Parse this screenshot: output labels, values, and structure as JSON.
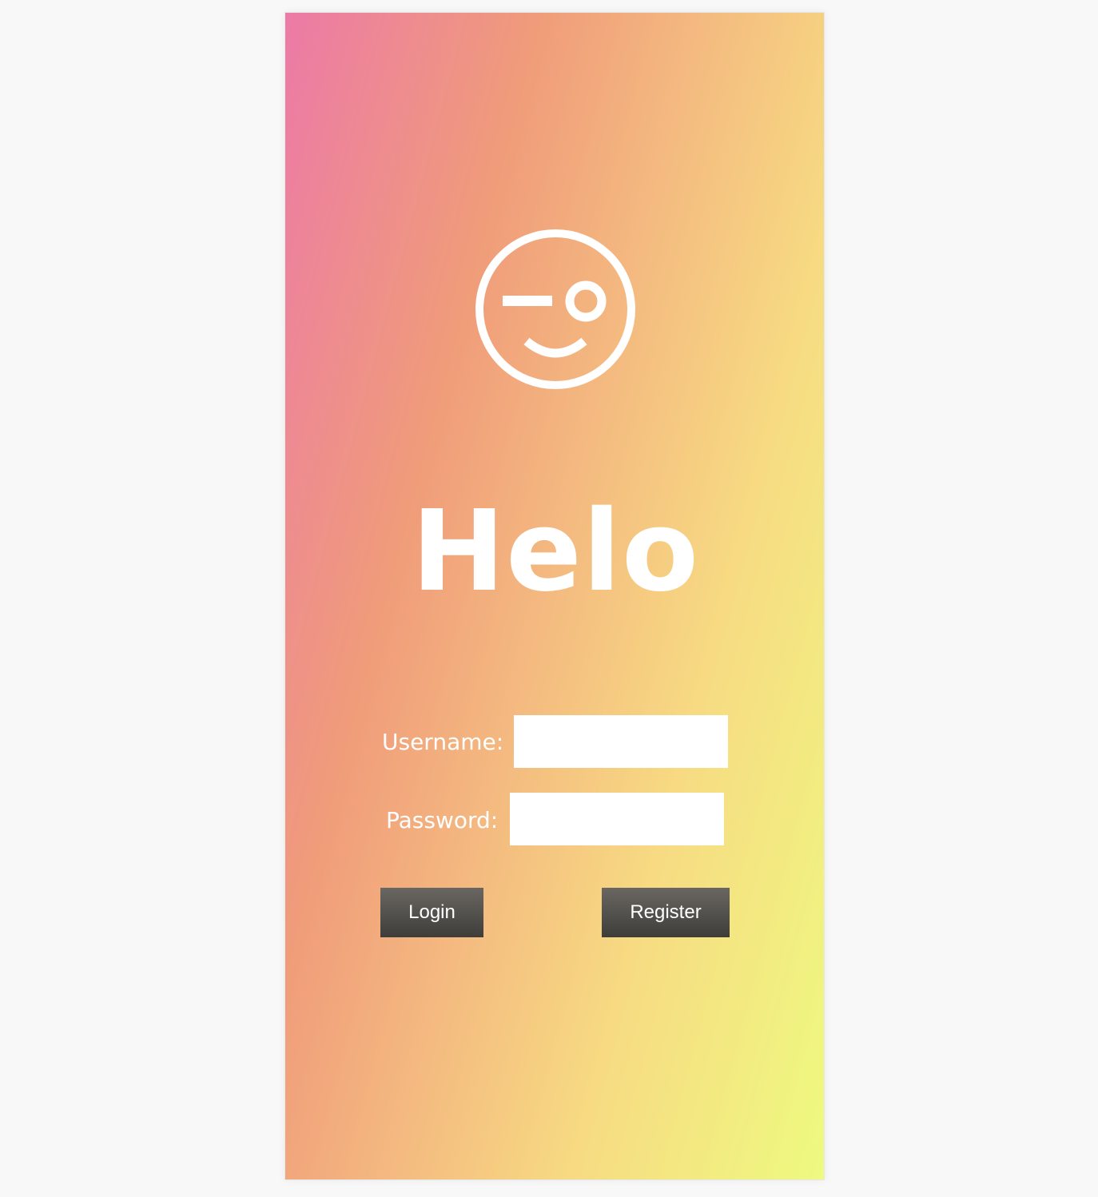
{
  "app": {
    "title": "Helo",
    "logo_icon": "wink-face-icon"
  },
  "form": {
    "username_label": "Username:",
    "username_value": "",
    "password_label": "Password:",
    "password_value": "",
    "login_label": "Login",
    "register_label": "Register"
  },
  "colors": {
    "gradient_start": "#ec7aa6",
    "gradient_mid": "#f4bb80",
    "gradient_end": "#eefa80",
    "button": "#4a4945",
    "text": "#ffffff"
  }
}
